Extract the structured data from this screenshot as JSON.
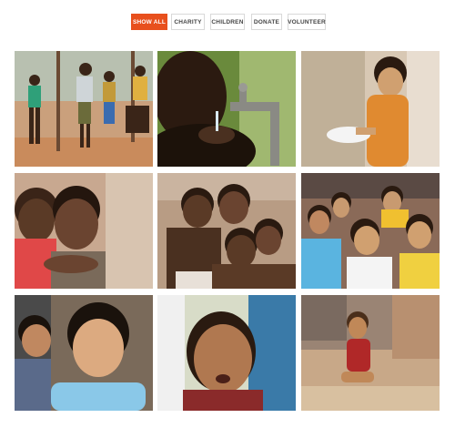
{
  "accent_color": "#e8501d",
  "filters": [
    {
      "label": "SHOW ALL",
      "active": true
    },
    {
      "label": "CHARITY",
      "active": false
    },
    {
      "label": "CHILDREN",
      "active": false
    },
    {
      "label": "DONATE",
      "active": false
    },
    {
      "label": "VOLUNTEER",
      "active": false
    }
  ],
  "gallery": [
    {
      "subject": "four children standing outdoors on dusty ground"
    },
    {
      "subject": "child drinking water from a tap"
    },
    {
      "subject": "child holding a white bowl"
    },
    {
      "subject": "two children smiling together"
    },
    {
      "subject": "group of children hugging"
    },
    {
      "subject": "crowd of smiling children"
    },
    {
      "subject": "two children, girl in light blue shirt"
    },
    {
      "subject": "crying toddler close-up"
    },
    {
      "subject": "toddler in red dress sitting on the ground"
    }
  ]
}
